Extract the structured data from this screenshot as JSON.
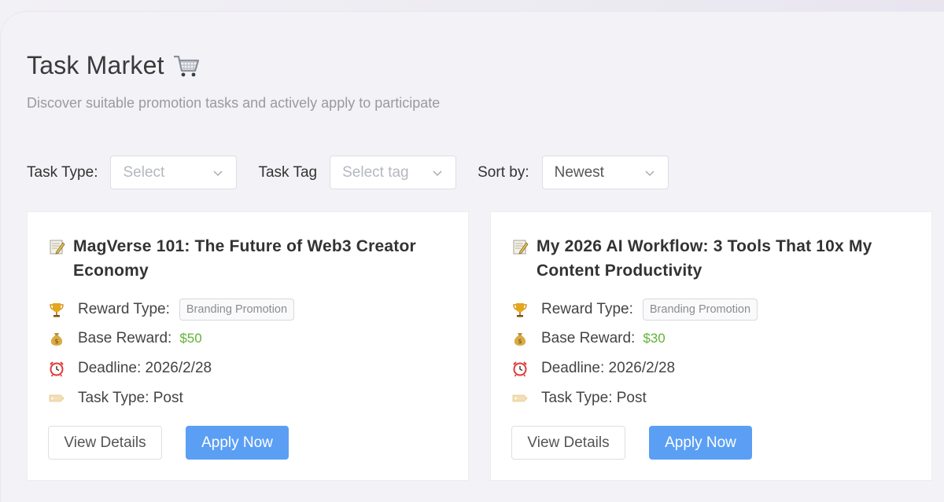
{
  "header": {
    "title": "Task Market",
    "subtitle": "Discover suitable promotion tasks and actively apply to participate"
  },
  "filters": {
    "task_type_label": "Task Type:",
    "task_type_placeholder": "Select",
    "task_tag_label": "Task Tag",
    "task_tag_placeholder": "Select tag",
    "sort_label": "Sort by:",
    "sort_value": "Newest"
  },
  "tasks": [
    {
      "title": "MagVerse 101: The Future of Web3 Creator Economy",
      "reward_type_label": "Reward Type:",
      "reward_type": "Branding Promotion",
      "base_reward_label": "Base Reward:",
      "base_reward": "$50",
      "deadline": "Deadline: 2026/2/28",
      "task_type": "Task Type: Post",
      "details_label": "View Details",
      "apply_label": "Apply Now"
    },
    {
      "title": "My 2026 AI Workflow: 3 Tools That 10x My Content Productivity",
      "reward_type_label": "Reward Type:",
      "reward_type": "Branding Promotion",
      "base_reward_label": "Base Reward:",
      "base_reward": "$30",
      "deadline": "Deadline: 2026/2/28",
      "task_type": "Task Type: Post",
      "details_label": "View Details",
      "apply_label": "Apply Now"
    }
  ],
  "icons": {
    "title": "shopping-cart-icon",
    "card_title": "memo-icon",
    "reward_type": "trophy-icon",
    "base_reward": "money-bag-icon",
    "deadline": "alarm-clock-icon",
    "task_type": "label-tag-icon"
  },
  "colors": {
    "primary": "#5b9ff4",
    "reward": "#5fb336",
    "background": "#f3f2f6"
  }
}
